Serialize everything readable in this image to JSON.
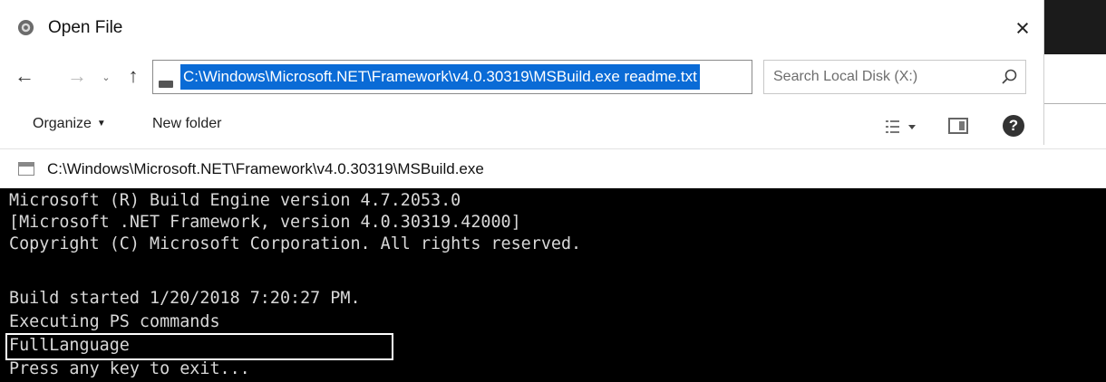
{
  "dialog": {
    "title": "Open File",
    "close_glyph": "×",
    "nav": {
      "back_glyph": "←",
      "forward_glyph": "→",
      "recent_glyph": "⌄",
      "up_glyph": "↑",
      "refresh_glyph": "↻"
    },
    "address": {
      "value": "C:\\Windows\\Microsoft.NET\\Framework\\v4.0.30319\\MSBuild.exe readme.txt"
    },
    "search": {
      "placeholder": "Search Local Disk (X:)"
    },
    "toolbar": {
      "organize_label": "Organize",
      "organize_caret": "▼",
      "new_folder_label": "New folder",
      "help_glyph": "?"
    },
    "icons": {
      "app": "app-icon",
      "drive": "drive-icon",
      "search": "search-icon",
      "view": "view-options-icon",
      "pane": "preview-pane-icon",
      "help": "help-icon"
    }
  },
  "console": {
    "title": "C:\\Windows\\Microsoft.NET\\Framework\\v4.0.30319\\MSBuild.exe",
    "lines": [
      "Microsoft (R) Build Engine version 4.7.2053.0",
      "[Microsoft .NET Framework, version 4.0.30319.42000]",
      "Copyright (C) Microsoft Corporation. All rights reserved.",
      "",
      "Build started 1/20/2018 7:20:27 PM.",
      "Executing PS commands",
      "FullLanguage",
      "Press any key to exit..."
    ],
    "highlighted_line": "FullLanguage"
  },
  "colors": {
    "selection": "#0a6bd6",
    "console_bg": "#000000",
    "console_text": "#d8d8d8"
  }
}
